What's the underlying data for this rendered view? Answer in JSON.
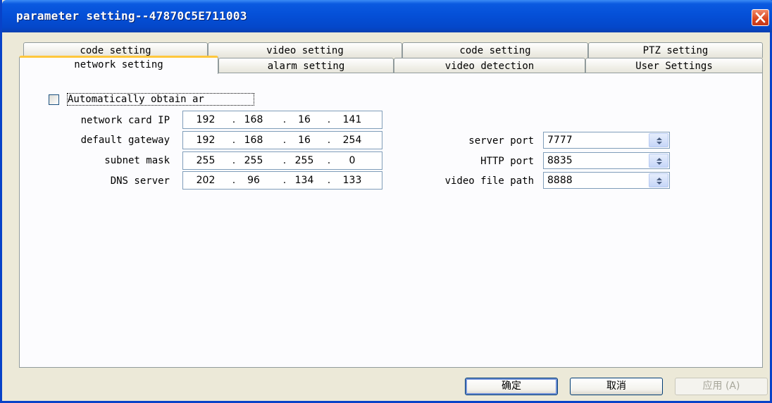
{
  "window": {
    "title": "parameter setting--47870C5E711003",
    "close_icon": "close-icon"
  },
  "tabs": {
    "row1": [
      "code setting",
      "video setting",
      "code setting",
      "PTZ setting"
    ],
    "row2": [
      "network setting",
      "alarm setting",
      "video detection",
      "User Settings"
    ],
    "active": "network setting"
  },
  "network": {
    "auto_obtain_label": "Automatically obtain ar",
    "auto_obtain_checked": false,
    "fields": [
      {
        "label": "network card IP",
        "octets": [
          "192",
          "168",
          "16",
          "141"
        ]
      },
      {
        "label": "default gateway",
        "octets": [
          "192",
          "168",
          "16",
          "254"
        ]
      },
      {
        "label": "subnet mask",
        "octets": [
          "255",
          "255",
          "255",
          "0"
        ]
      },
      {
        "label": "DNS server",
        "octets": [
          "202",
          "96",
          "134",
          "133"
        ]
      }
    ],
    "ports": [
      {
        "label": "server port",
        "value": "7777"
      },
      {
        "label": "HTTP port",
        "value": "8835"
      },
      {
        "label": "video file path",
        "value": "8888"
      }
    ]
  },
  "buttons": {
    "ok": "确定",
    "cancel": "取消",
    "apply": "应用 (A)"
  }
}
